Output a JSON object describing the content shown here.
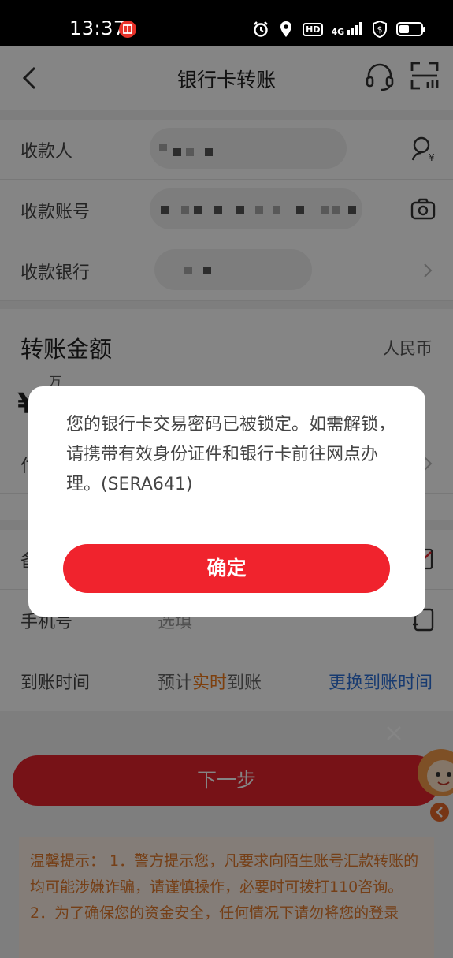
{
  "status_bar": {
    "time": "13:37",
    "app_badge": "CITIC",
    "network": "4G",
    "hd": "HD"
  },
  "nav": {
    "title": "银行卡转账"
  },
  "form": {
    "payee_label": "收款人",
    "account_label": "收款账号",
    "bank_label": "收款银行",
    "amount_label": "转账金额",
    "currency": "人民币",
    "amount_unit_hint": "万",
    "amount_symbol": "¥",
    "payment_row_partial": "付",
    "remark_row_partial": "备",
    "phone_label": "手机号",
    "phone_placeholder": "选填",
    "arrival_label": "到账时间",
    "arrival_prefix": "预计",
    "arrival_highlight": "实时",
    "arrival_suffix": "到账",
    "change_arrival": "更换到账时间"
  },
  "next_button": "下一步",
  "tips": {
    "line1": "温馨提示：  1．警方提示您，凡要求向陌生账号汇款转账的均可能涉嫌诈骗，请谨慎操作，必要时可拨打110咨询。",
    "line2": "2．为了确保您的资金安全，任何情况下请勿将您的登录"
  },
  "dialog": {
    "message": "您的银行卡交易密码已被锁定。如需解锁，请携带有效身份证件和银行卡前往网点办理。(SERA641)",
    "confirm": "确定"
  },
  "colors": {
    "accent": "#e5242c",
    "link": "#2c6fd6",
    "highlight": "#f07a1a",
    "tips_text": "#e07a2c"
  }
}
